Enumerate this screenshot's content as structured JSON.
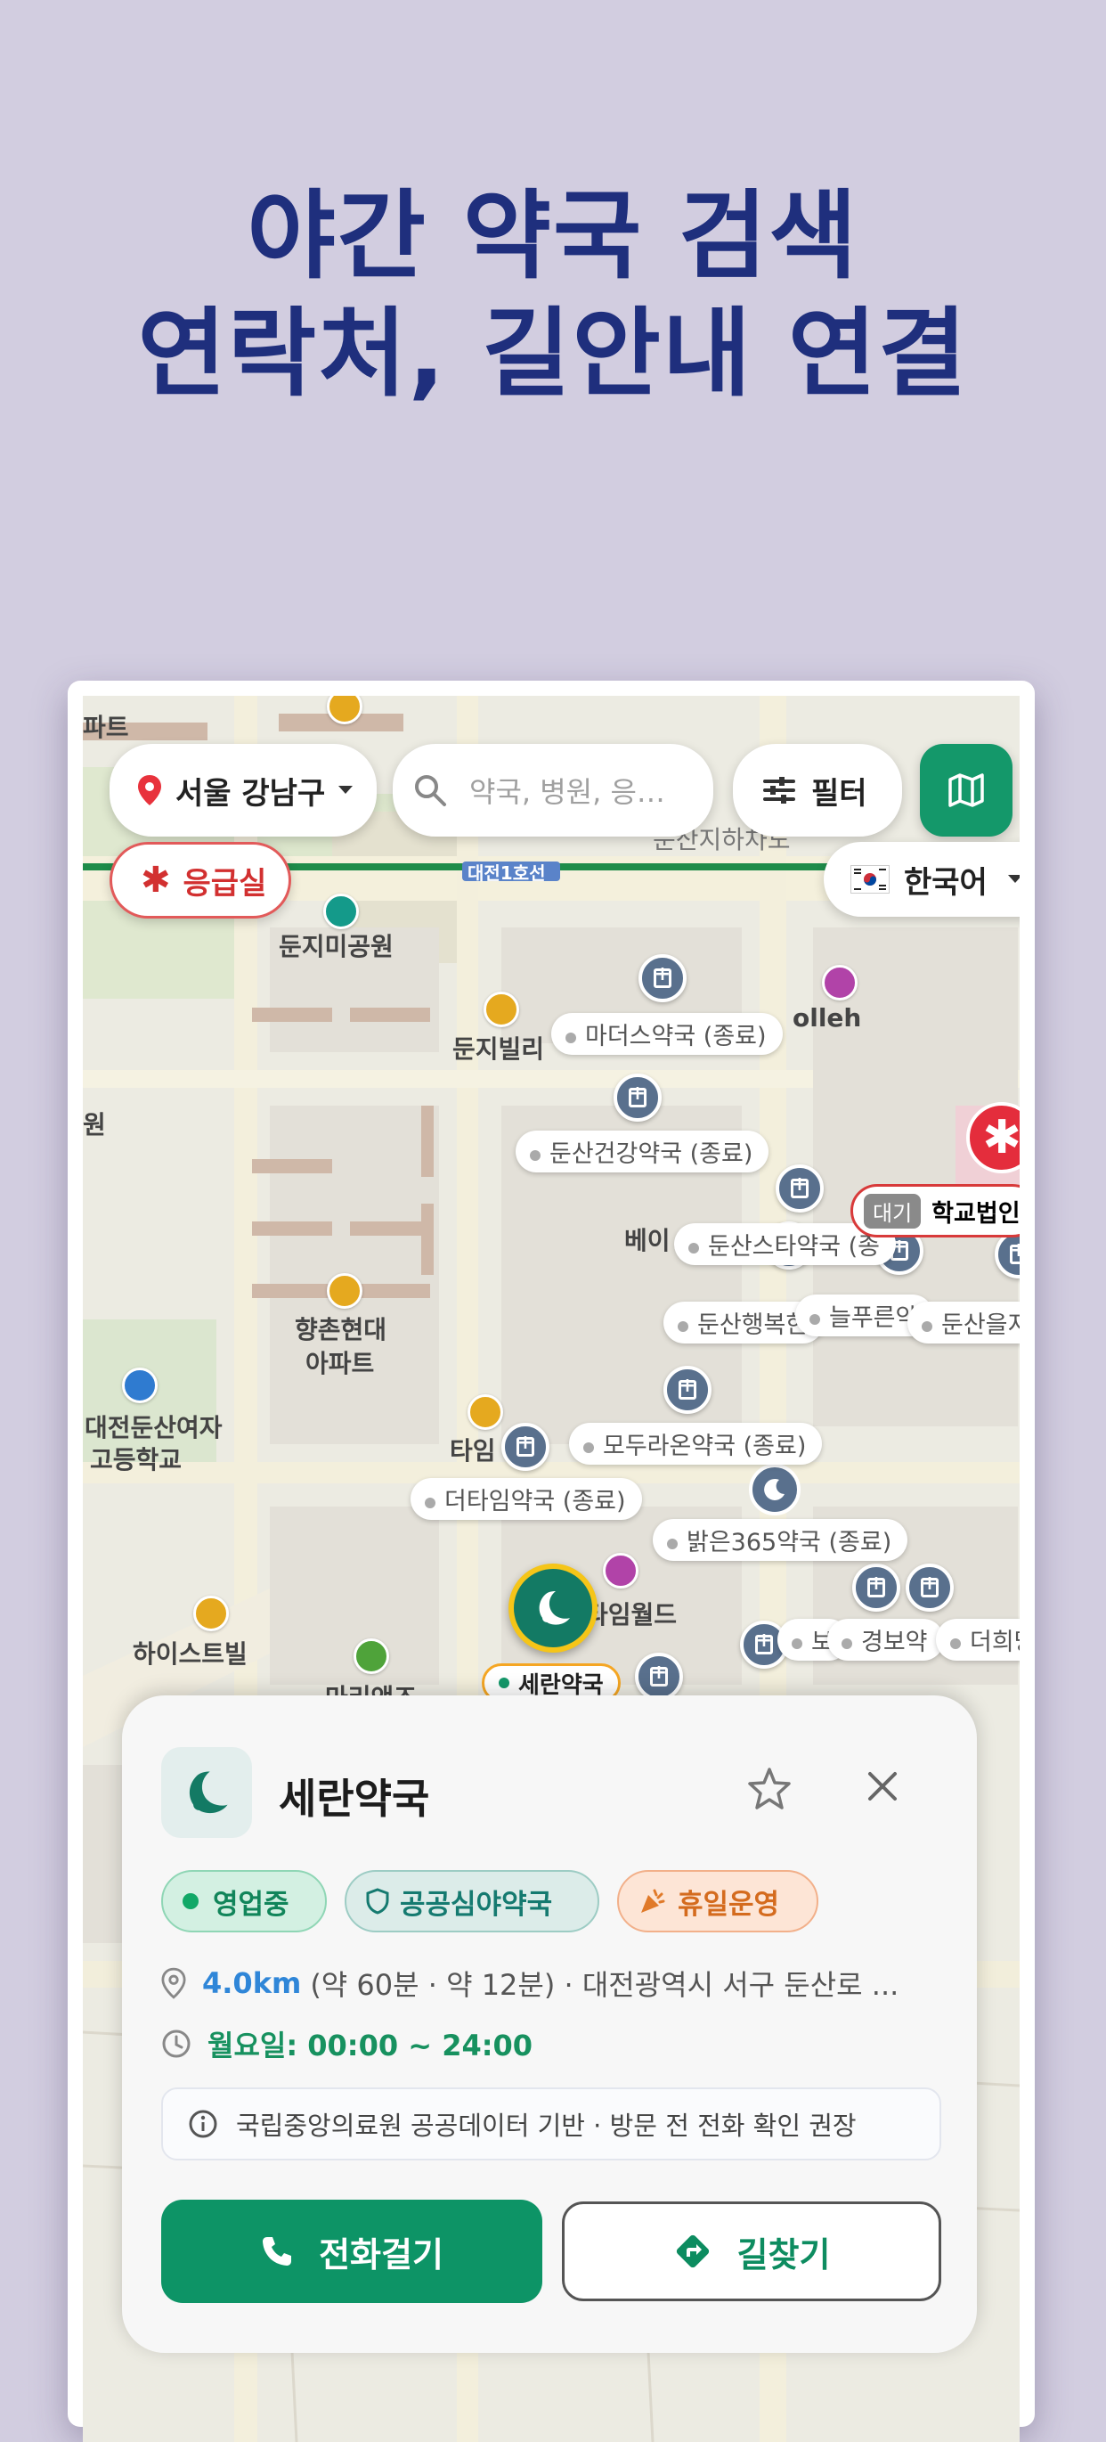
{
  "headline": {
    "line1": "야간 약국 검색",
    "line2": "연락처, 길안내 연결"
  },
  "topbar": {
    "location_label": "서울 강남구",
    "search_placeholder": "약국, 병원, 응…",
    "filter_label": "필터",
    "emergency_label": "응급실",
    "language_label": "한국어"
  },
  "map": {
    "subway_line_label": "대전1호선",
    "area_labels": {
      "underground": "둔산지하차도",
      "park": "둔지미공원",
      "villa": "둔지빌리",
      "olleh": "olleh",
      "apt1": "향촌현대",
      "apt2": "아파트",
      "school1": "대전둔산여자",
      "school2": "고등학교",
      "hiestville": "하이스트빌",
      "taim": "타임",
      "world": "타임월드",
      "bei": "베이",
      "left_edge1": "파트",
      "left_edge2": "원",
      "left_edge3": "마리앤즈"
    },
    "pharmacies": [
      {
        "name": "마더스약국 (종료)"
      },
      {
        "name": "둔산건강약국 (종료)"
      },
      {
        "name": "둔산스타약국 (종"
      },
      {
        "name": "둔산행복한"
      },
      {
        "name": "늘푸른약"
      },
      {
        "name": "둔산을지"
      },
      {
        "name": "모두라온약국 (종료)"
      },
      {
        "name": "더타임약국 (종료)"
      },
      {
        "name": "밝은365약국 (종료)"
      },
      {
        "name": "보"
      },
      {
        "name": "경보약"
      },
      {
        "name": "더희망"
      }
    ],
    "hospital_badge": "대기",
    "hospital_name": "학교법인",
    "selected_marker_label": "세란약국"
  },
  "sheet": {
    "pharmacy_name": "세란약국",
    "chips": {
      "open": "영업중",
      "night": "공공심야약국",
      "holiday": "휴일운영"
    },
    "distance": "4.0km",
    "distance_detail": "(약 60분 · 약 12분) · 대전광역시 서구 둔산로 ...",
    "hours": "월요일: 00:00 ~ 24:00",
    "notice": "국립중앙의료원 공공데이터 기반 · 방문 전 전화 확인 권장",
    "call_label": "전화걸기",
    "route_label": "길찾기"
  },
  "colors": {
    "background": "#d2cde0",
    "headline": "#1f2f7d",
    "accent_green": "#14986a",
    "emergency_red": "#d23030",
    "distance_blue": "#2f86d8"
  },
  "icons": [
    "location-pin-icon",
    "search-icon",
    "filter-icon",
    "map-icon",
    "asterisk-icon",
    "korea-flag-icon",
    "chevron-down-icon",
    "pharmacy-marker-icon",
    "moon-icon",
    "star-icon",
    "close-icon",
    "shield-icon",
    "party-icon",
    "phone-icon",
    "directions-icon",
    "clock-icon",
    "info-icon"
  ]
}
